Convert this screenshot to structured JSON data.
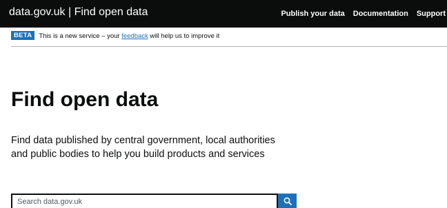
{
  "header": {
    "brand": "data.gov.uk | Find open data",
    "nav": [
      "Publish your data",
      "Documentation",
      "Support"
    ]
  },
  "beta_banner": {
    "tag": "BETA",
    "text_before": "This is a new service – your ",
    "link": "feedback",
    "text_after": " will help us to improve it"
  },
  "main": {
    "title": "Find open data",
    "lead": "Find data published by central government, local authorities and public bodies to help you build products and services"
  },
  "search": {
    "placeholder": "Search data.gov.uk",
    "button_icon": "search-icon"
  },
  "colors": {
    "header_bg": "#0b0c0c",
    "accent": "#1d70b8",
    "text": "#0b0c0c"
  }
}
